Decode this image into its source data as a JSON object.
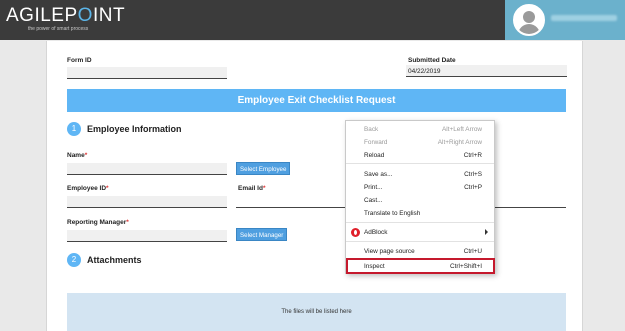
{
  "header": {
    "brand_prefix": "AGILEP",
    "brand_dot": "O",
    "brand_suffix": "INT",
    "tagline": "the power of smart process"
  },
  "form": {
    "form_id_label": "Form ID",
    "form_id_value": "",
    "submitted_date_label": "Submitted Date",
    "submitted_date_value": "04/22/2019",
    "title": "Employee Exit Checklist Request",
    "section1_number": "1",
    "section1_title": "Employee Information",
    "name_label": "Name",
    "select_employee_label": "Select Employee",
    "employee_id_label": "Employee ID",
    "email_label": "Email Id",
    "reporting_manager_label": "Reporting Manager",
    "select_manager_label": "Select Manager",
    "section2_number": "2",
    "section2_title": "Attachments",
    "dropzone_text": "The files will be listed here",
    "required_marker": "*"
  },
  "context_menu": {
    "back": {
      "label": "Back",
      "shortcut": "Alt+Left Arrow"
    },
    "forward": {
      "label": "Forward",
      "shortcut": "Alt+Right Arrow"
    },
    "reload": {
      "label": "Reload",
      "shortcut": "Ctrl+R"
    },
    "save_as": {
      "label": "Save as...",
      "shortcut": "Ctrl+S"
    },
    "print": {
      "label": "Print...",
      "shortcut": "Ctrl+P"
    },
    "cast": {
      "label": "Cast...",
      "shortcut": ""
    },
    "translate": {
      "label": "Translate to English",
      "shortcut": ""
    },
    "adblock": {
      "label": "AdBlock",
      "shortcut": ""
    },
    "view_source": {
      "label": "View page source",
      "shortcut": "Ctrl+U"
    },
    "inspect": {
      "label": "Inspect",
      "shortcut": "Ctrl+Shift+I"
    }
  },
  "colors": {
    "accent": "#5fb6f5",
    "highlight_border": "#c5192d",
    "topbar": "#3b3b3b",
    "user_panel": "#6bb1cc"
  }
}
